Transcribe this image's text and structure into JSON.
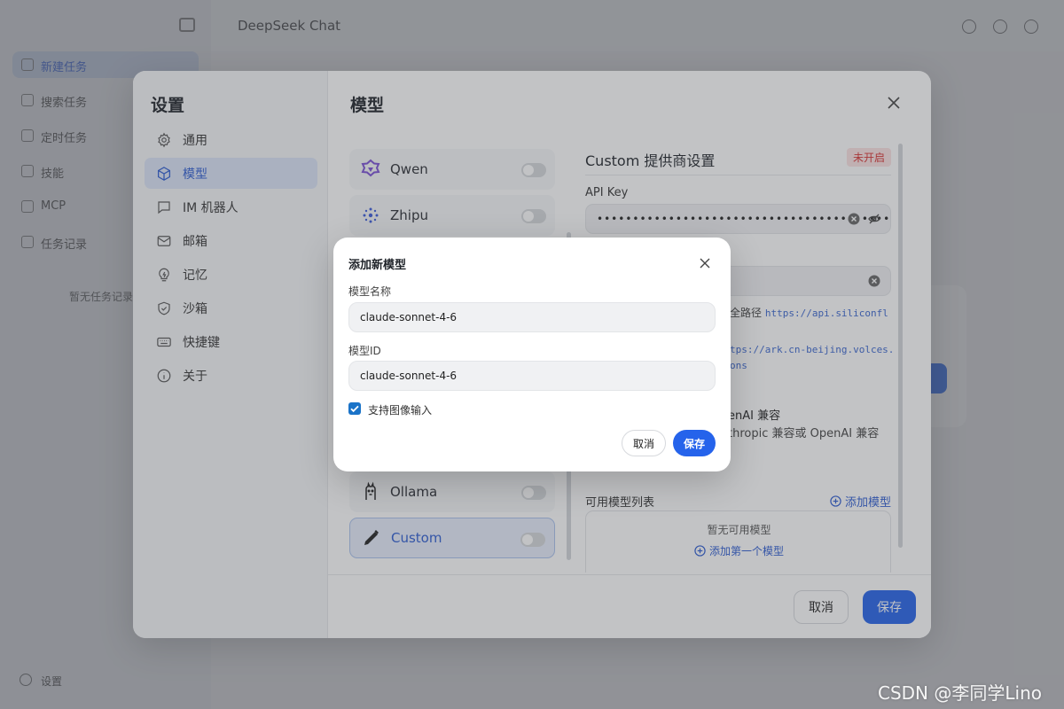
{
  "background_app": {
    "title": "DeepSeek Chat",
    "nav_items": [
      "新建任务",
      "搜索任务",
      "定时任务",
      "技能",
      "MCP",
      "任务记录"
    ],
    "empty_text": "暂无任务记录",
    "bottom_label": "设置"
  },
  "settings": {
    "title": "设置",
    "nav": [
      {
        "label": "通用",
        "icon": "gear-icon"
      },
      {
        "label": "模型",
        "icon": "cube-icon",
        "active": true
      },
      {
        "label": "IM 机器人",
        "icon": "chat-bubble-icon"
      },
      {
        "label": "邮箱",
        "icon": "mail-icon"
      },
      {
        "label": "记忆",
        "icon": "lightbulb-icon"
      },
      {
        "label": "沙箱",
        "icon": "shield-icon"
      },
      {
        "label": "快捷键",
        "icon": "keyboard-icon"
      },
      {
        "label": "关于",
        "icon": "info-icon"
      }
    ],
    "section_title": "模型",
    "providers": [
      {
        "name": "Qwen",
        "icon": "qwen-icon",
        "enabled": false
      },
      {
        "name": "Zhipu",
        "icon": "zhipu-icon",
        "enabled": false
      },
      {
        "name": "Ollama",
        "icon": "ollama-icon",
        "enabled": false
      },
      {
        "name": "Custom",
        "icon": "pencil-icon",
        "enabled": false,
        "active": true
      }
    ],
    "detail": {
      "title": "Custom 提供商设置",
      "status_badge": "未开启",
      "api_key_label": "API Key",
      "api_key_value": "••••••••••••••••••••••••••••••••••••••••••••••••••",
      "hint_full_path": "全路径",
      "hint_url1": "https://api.siliconfl",
      "hint_url2": "tps://ark.cn-beijing.volces.",
      "hint_url3": "ons",
      "compat_title": "enAI 兼容",
      "compat_desc": "thropic 兼容或 OpenAI 兼容",
      "model_list_title": "可用模型列表",
      "add_model_link": "添加模型",
      "empty_models": "暂无可用模型",
      "add_first_model": "添加第一个模型"
    },
    "footer": {
      "cancel": "取消",
      "save": "保存"
    }
  },
  "add_model_modal": {
    "title": "添加新模型",
    "name_label": "模型名称",
    "name_value": "claude-sonnet-4-6",
    "id_label": "模型ID",
    "id_value": "claude-sonnet-4-6",
    "image_input_label": "支持图像输入",
    "image_input_checked": true,
    "cancel": "取消",
    "save": "保存"
  },
  "colors": {
    "accent": "#2563eb",
    "badge_bg": "#fde3e3",
    "badge_text": "#d93030",
    "checkbox": "#1a73c8"
  },
  "watermark": "CSDN @李同学Lino"
}
